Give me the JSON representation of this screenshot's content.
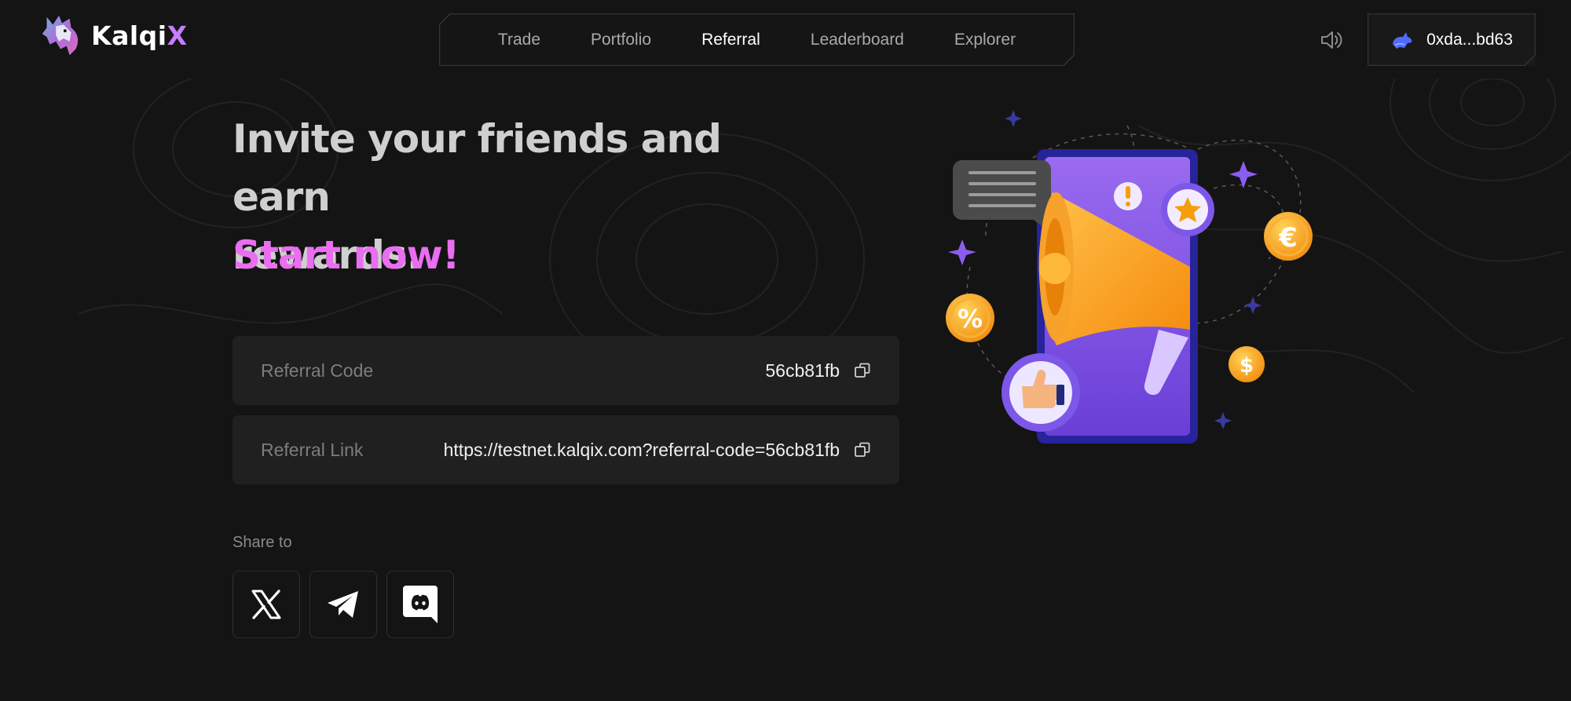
{
  "brand": {
    "name_main": "Kalqi",
    "name_accent": "X",
    "accent_color": "#c77dff"
  },
  "nav": {
    "items": [
      {
        "label": "Trade",
        "active": false
      },
      {
        "label": "Portfolio",
        "active": false
      },
      {
        "label": "Referral",
        "active": true
      },
      {
        "label": "Leaderboard",
        "active": false
      },
      {
        "label": "Explorer",
        "active": false
      }
    ]
  },
  "header": {
    "sound_icon": "speaker-icon",
    "wallet": {
      "icon": "rabbit-icon",
      "address": "0xda...bd63"
    }
  },
  "hero": {
    "headline_line1": "Invite your friends and earn",
    "headline_line2": "rewards.",
    "accent_line": "Start now!",
    "accent_color": "#e96ef0"
  },
  "referral": {
    "code_label": "Referral Code",
    "code_value": "56cb81fb",
    "link_label": "Referral Link",
    "link_value": "https://testnet.kalqix.com?referral-code=56cb81fb",
    "copy_icon": "copy-icon"
  },
  "share": {
    "label": "Share to",
    "targets": [
      "x-icon",
      "telegram-icon",
      "discord-icon"
    ]
  },
  "illustration": {
    "icon": "megaphone-phone-illustration"
  }
}
